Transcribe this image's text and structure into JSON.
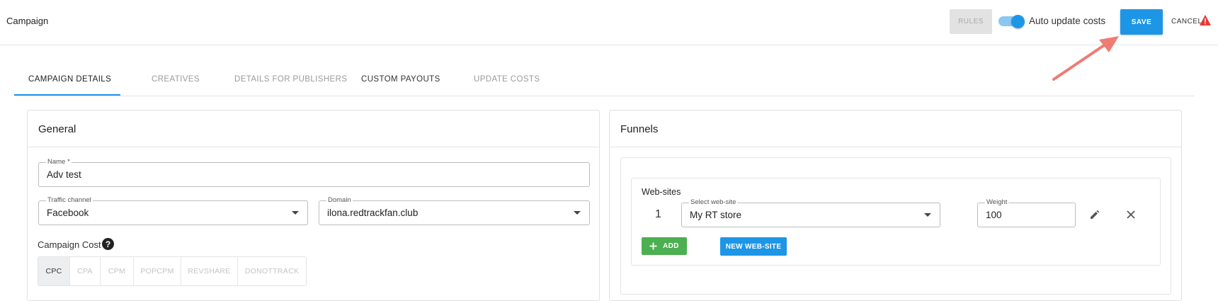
{
  "header": {
    "title": "Campaign",
    "rules_label": "RULES",
    "auto_update_label": "Auto update costs",
    "auto_update_on": true,
    "save_label": "SAVE",
    "cancel_label": "CANCEL"
  },
  "tabs": [
    {
      "label": "CAMPAIGN DETAILS",
      "active": true
    },
    {
      "label": "CREATIVES",
      "active": false
    },
    {
      "label": "DETAILS FOR PUBLISHERS",
      "active": false
    },
    {
      "label": "CUSTOM PAYOUTS",
      "active": false
    },
    {
      "label": "UPDATE COSTS",
      "active": false
    }
  ],
  "general": {
    "title": "General",
    "name": {
      "label": "Name *",
      "value": "Adv test"
    },
    "traffic_channel": {
      "label": "Traffic channel",
      "value": "Facebook"
    },
    "domain": {
      "label": "Domain",
      "value": "ilona.redtrackfan.club"
    },
    "campaign_cost_label": "Campaign Cost",
    "help_glyph": "?",
    "cost_models": [
      "CPC",
      "CPA",
      "CPM",
      "POPCPM",
      "REVSHARE",
      "DONOTTRACK"
    ],
    "cost_model_selected": "CPC"
  },
  "funnels": {
    "title": "Funnels",
    "websites_title": "Web-sites",
    "row_number": "1",
    "select_label": "Select web-site",
    "select_value": "My RT store",
    "weight_label": "Weight",
    "weight_value": "100",
    "add_label": "ADD",
    "new_website_label": "NEW WEB-SITE"
  },
  "colors": {
    "primary": "#1e96e6",
    "add_green": "#4caf50",
    "warning_red": "#e53935",
    "arrow_salmon": "#f07b74"
  }
}
